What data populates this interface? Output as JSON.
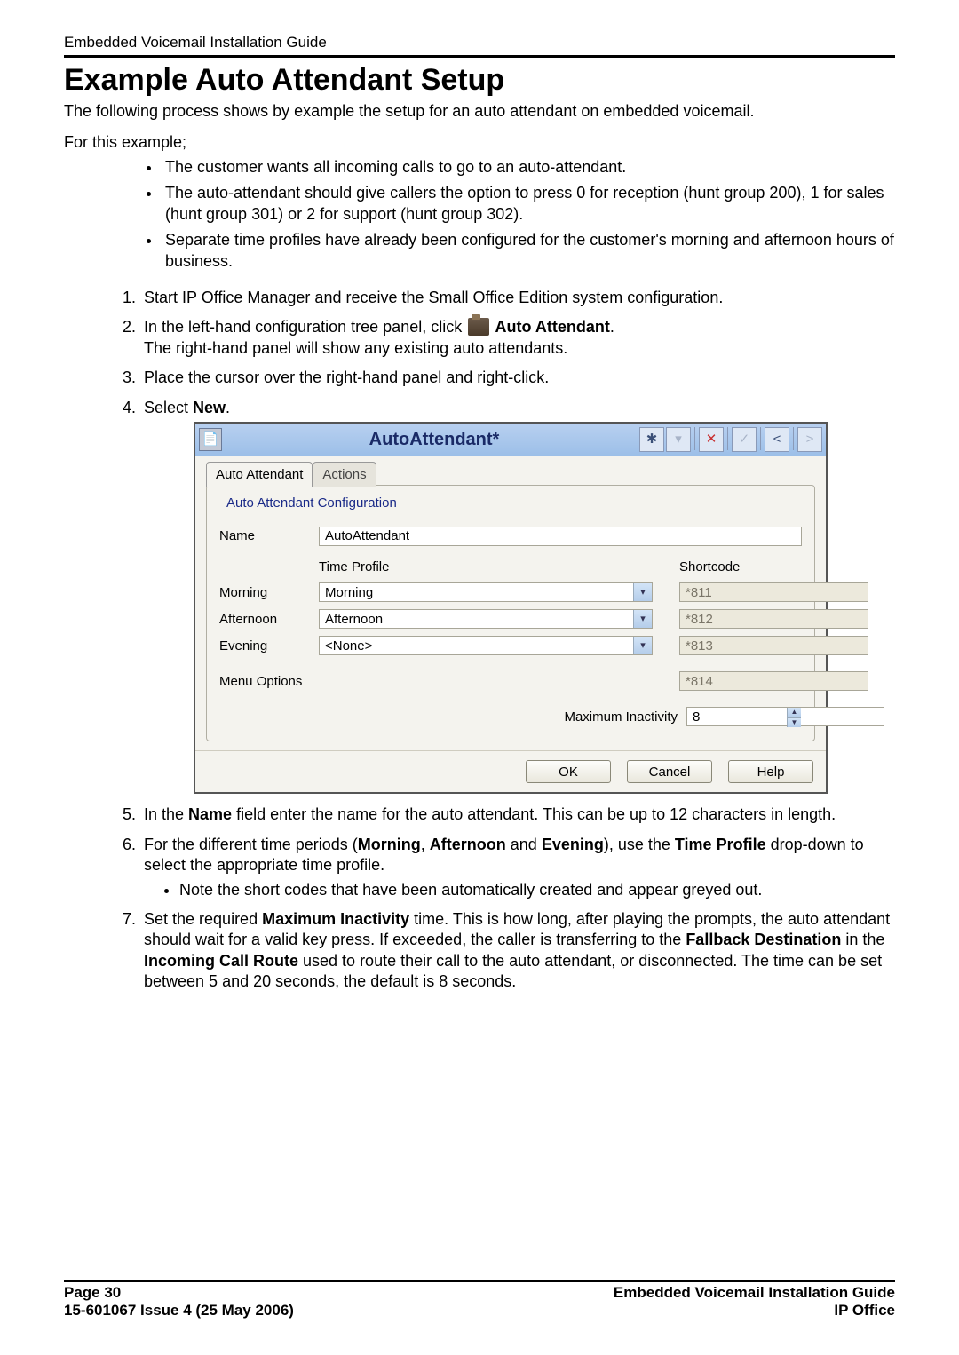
{
  "header": {
    "running": "Embedded Voicemail Installation Guide"
  },
  "title": "Example Auto Attendant Setup",
  "intro1": "The following process shows by example the setup for an auto attendant on embedded voicemail.",
  "intro2": "For this example;",
  "bullets": [
    "The customer wants all incoming calls to go to an auto-attendant.",
    "The auto-attendant should give callers the option to press 0 for reception (hunt group 200), 1 for sales (hunt group 301) or 2 for support (hunt group 302).",
    "Separate time profiles have already been configured for the customer's morning and afternoon hours of business."
  ],
  "steps": {
    "1": "Start IP Office Manager and receive the Small Office Edition system configuration.",
    "2a": "In the left-hand configuration tree panel, click ",
    "2b_bold": " Auto Attendant",
    "2c": ".",
    "2d": "The right-hand panel will show any existing auto attendants.",
    "3": "Place the cursor over the right-hand panel and right-click.",
    "4a": "Select ",
    "4b_bold": "New",
    "4c": ".",
    "5a": "In the ",
    "5b_bold": "Name",
    "5c": " field enter the name for the auto attendant. This can be up to 12 characters in length.",
    "6a": "For the different time periods (",
    "6_morning": "Morning",
    "6_sep1": ", ",
    "6_afternoon": "Afternoon",
    "6_sep2": " and ",
    "6_evening": "Evening",
    "6b": "), use the ",
    "6c_bold": "Time Profile",
    "6d": " drop-down to select the appropriate time profile.",
    "6_note": "Note the short codes that have been automatically created and appear greyed out.",
    "7a": "Set the required ",
    "7b_bold": "Maximum Inactivity",
    "7c": " time. This is how long, after playing the prompts, the auto attendant should wait for a valid key press. If exceeded, the caller is transferring to the ",
    "7d_bold": "Fallback Destination",
    "7e": " in the ",
    "7f_bold": "Incoming Call Route",
    "7g": " used to route their call to the auto attendant, or disconnected. The time can be set between 5 and 20 seconds, the default is 8 seconds."
  },
  "dialog": {
    "title": "AutoAttendant*",
    "tabs": {
      "aa": "Auto Attendant",
      "actions": "Actions"
    },
    "legend": "Auto Attendant Configuration",
    "name_label": "Name",
    "name_value": "AutoAttendant",
    "hdr_timeprofile": "Time Profile",
    "hdr_shortcode": "Shortcode",
    "rows": [
      {
        "label": "Morning",
        "tp": "Morning",
        "sc": "*811"
      },
      {
        "label": "Afternoon",
        "tp": "Afternoon",
        "sc": "*812"
      },
      {
        "label": "Evening",
        "tp": "<None>",
        "sc": "*813"
      }
    ],
    "menu_options_label": "Menu Options",
    "menu_options_sc": "*814",
    "max_inactivity_label": "Maximum Inactivity",
    "max_inactivity_value": "8",
    "buttons": {
      "ok": "OK",
      "cancel": "Cancel",
      "help": "Help"
    }
  },
  "footer": {
    "page": "Page 30",
    "doc": "15-601067 Issue 4 (25 May 2006)",
    "title": "Embedded Voicemail Installation Guide",
    "product": "IP Office"
  }
}
